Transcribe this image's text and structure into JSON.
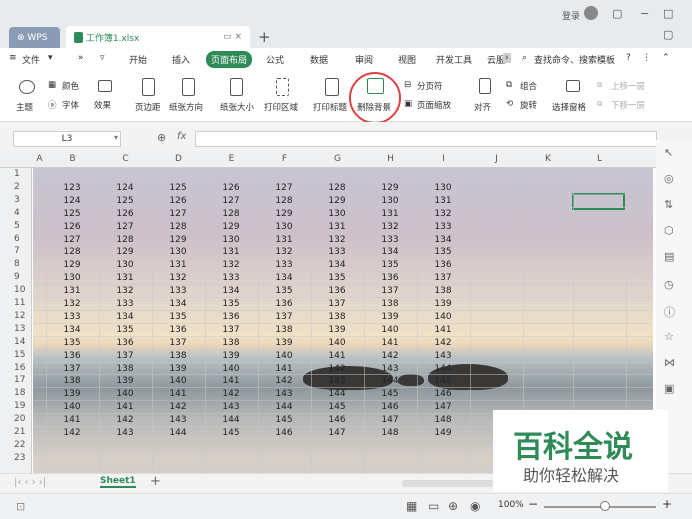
{
  "titlebar": {
    "login": "登录",
    "tab_wps": "WPS",
    "tab_file": "工作簿1.xlsx"
  },
  "menubar": {
    "file": "文件",
    "items": [
      "开始",
      "插入",
      "页面布局",
      "公式",
      "数据",
      "审阅",
      "视图",
      "开发工具",
      "云服"
    ],
    "search": "查找命令、搜索模板"
  },
  "ribbon": {
    "theme": "主题",
    "color": "颜色",
    "font": "字体",
    "effect": "效果",
    "margins": "页边距",
    "orientation": "纸张方向",
    "size": "纸张大小",
    "print_area": "打印区域",
    "print_titles": "打印标题",
    "delete_bg": "删除背景",
    "page_break": "分页符",
    "page_zoom": "页面缩放",
    "align": "对齐",
    "group": "组合",
    "rotate": "旋转",
    "select_pane": "选择窗格",
    "bring_fwd": "上移一层",
    "send_back": "下移一层"
  },
  "formula": {
    "cell_ref": "L3",
    "fx": "fx"
  },
  "grid": {
    "columns": [
      "A",
      "B",
      "C",
      "D",
      "E",
      "F",
      "G",
      "H",
      "I",
      "J",
      "K",
      "L"
    ],
    "rows": [
      "1",
      "2",
      "3",
      "4",
      "5",
      "6",
      "7",
      "8",
      "9",
      "10",
      "11",
      "12",
      "13",
      "14",
      "15",
      "16",
      "17",
      "18",
      "19",
      "20",
      "21",
      "22",
      "23"
    ],
    "start_values": [
      123,
      124,
      125,
      126,
      127,
      128,
      129,
      130,
      131,
      132,
      133,
      134,
      135,
      136,
      137,
      138,
      139,
      140,
      141,
      142
    ]
  },
  "sheet_tab": "Sheet1",
  "status": {
    "zoom": "100%"
  },
  "watermark": {
    "line1": "百科全说",
    "line2": "助你轻松解决"
  }
}
